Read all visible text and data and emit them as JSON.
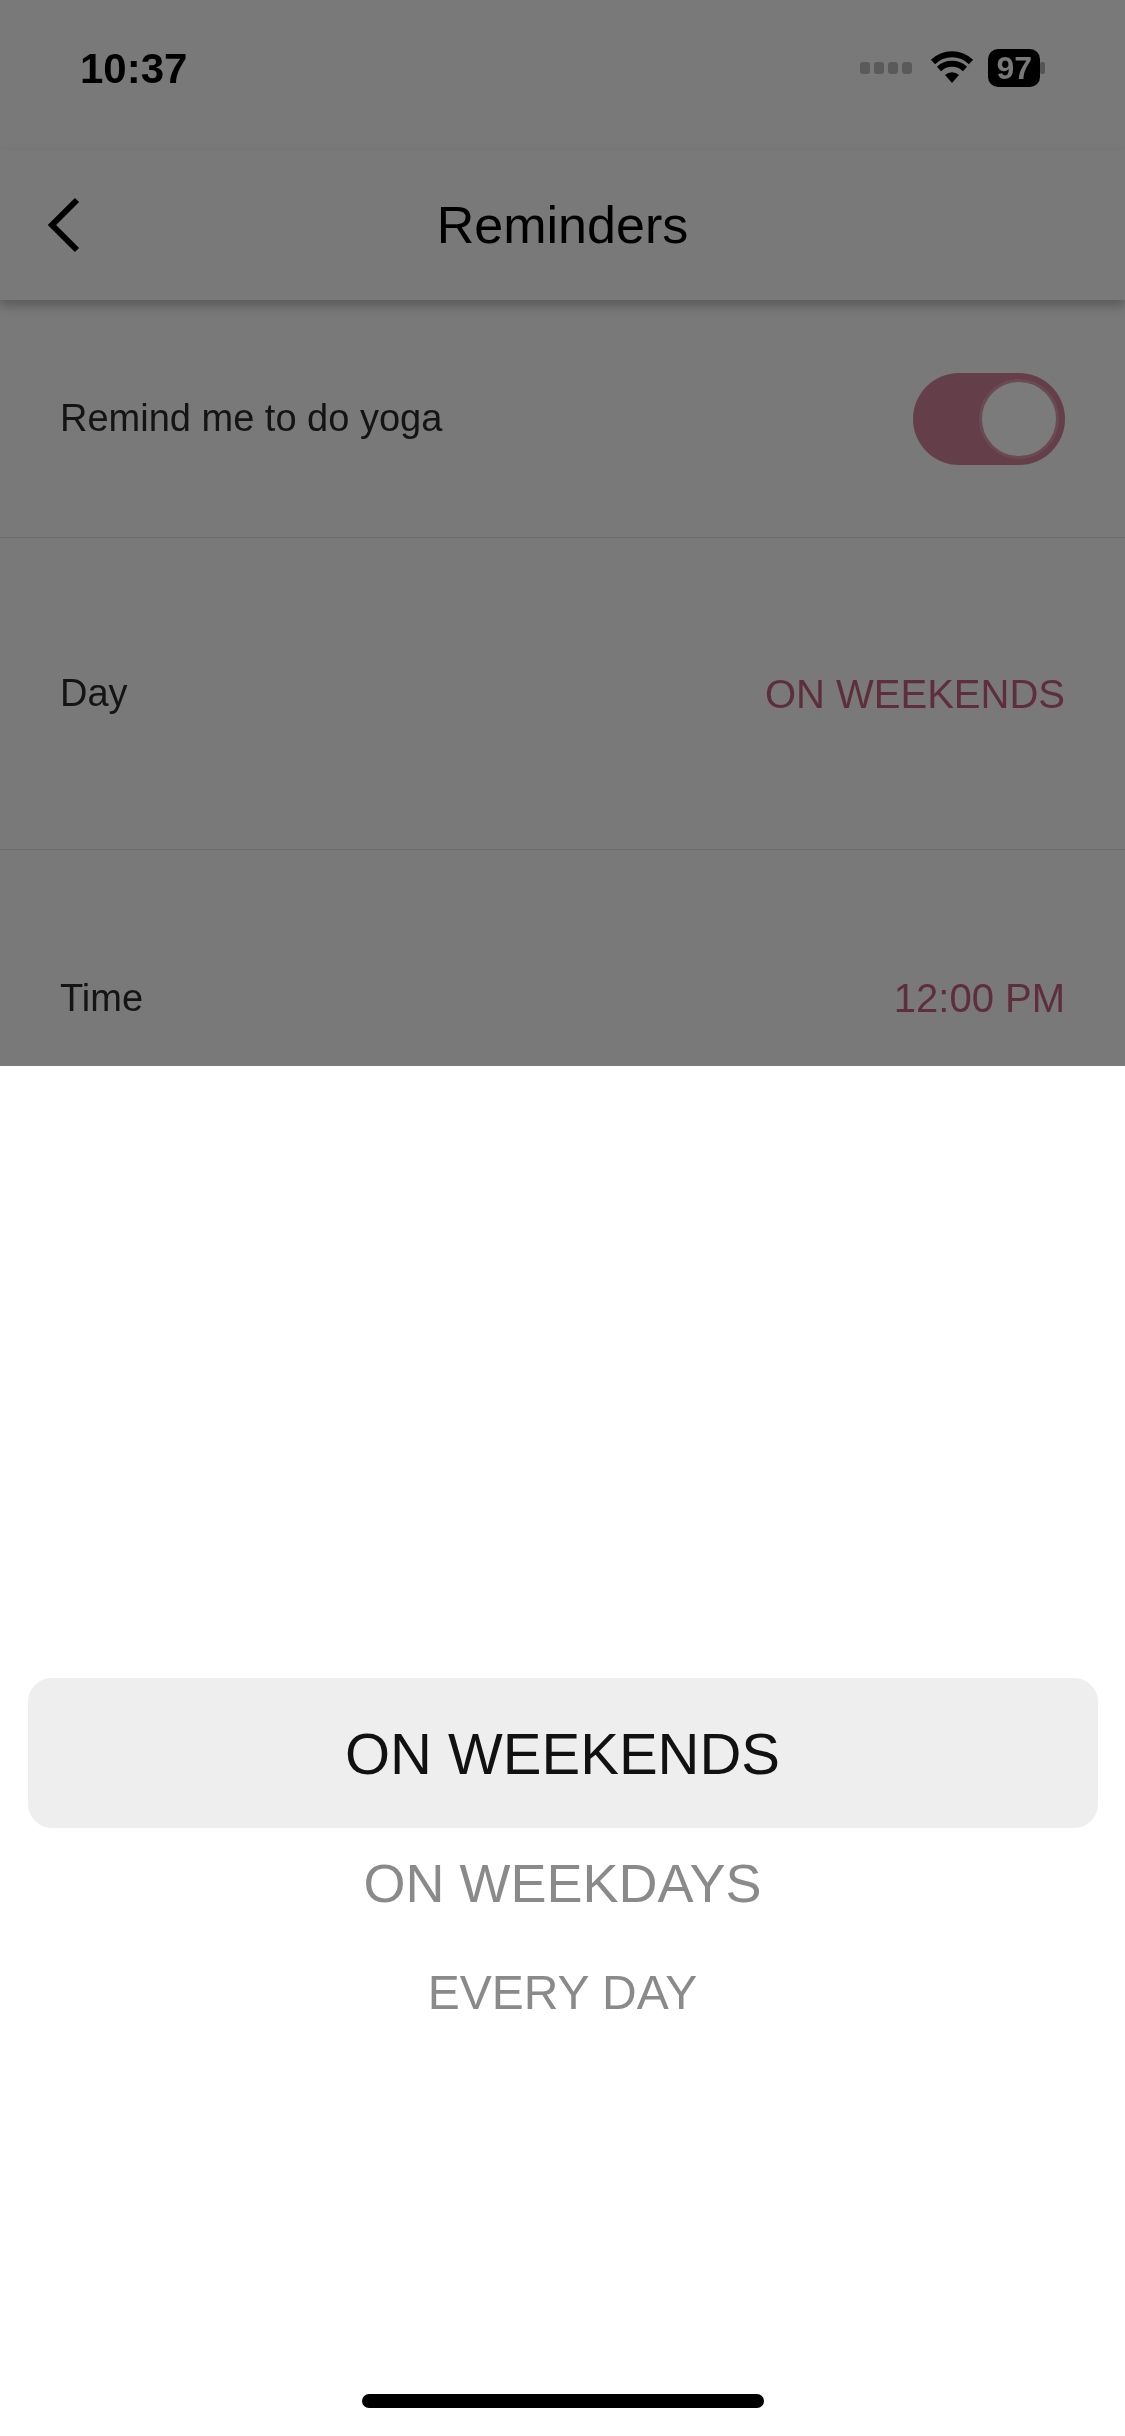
{
  "status_bar": {
    "time": "10:37",
    "battery": "97"
  },
  "header": {
    "title": "Reminders"
  },
  "rows": [
    {
      "kind": "toggle",
      "label": "Remind me to do yoga",
      "on": true
    },
    {
      "kind": "value",
      "label": "Day",
      "value": "ON WEEKENDS"
    },
    {
      "kind": "value",
      "label": "Time",
      "value": "12:00 PM"
    }
  ],
  "picker": {
    "options": [
      {
        "label": "ON WEEKENDS",
        "selected": true
      },
      {
        "label": "ON WEEKDAYS",
        "selected": false
      },
      {
        "label": "EVERY DAY",
        "selected": false
      }
    ]
  }
}
